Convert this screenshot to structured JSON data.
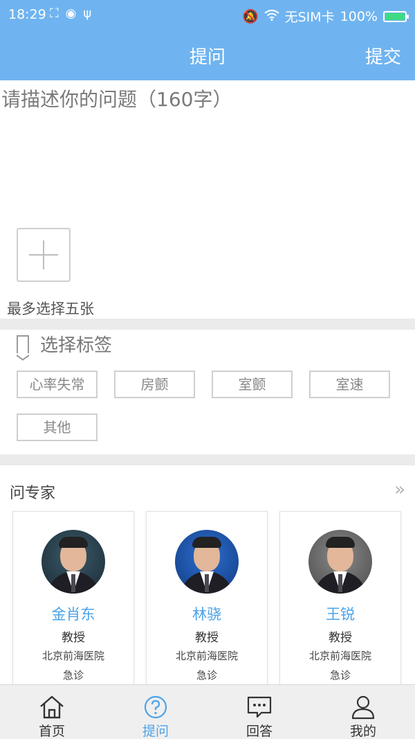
{
  "status_bar": {
    "time": "18:29",
    "left_icons": [
      "screenshot-icon",
      "fish-icon",
      "usb-icon"
    ],
    "network": "无SIM卡",
    "battery_label": "100%",
    "battery_level": 1.0
  },
  "header": {
    "title": "提问",
    "submit_label": "提交"
  },
  "question": {
    "placeholder": "请描述你的问题（160字）",
    "value": ""
  },
  "photos": {
    "hint": "最多选择五张"
  },
  "tags": {
    "title": "选择标签",
    "items": [
      {
        "label": "心率失常"
      },
      {
        "label": "房颤"
      },
      {
        "label": "室颤"
      },
      {
        "label": "室速"
      },
      {
        "label": "其他"
      }
    ]
  },
  "experts": {
    "title": "问专家",
    "items": [
      {
        "name": "金肖东",
        "rank": "教授",
        "hospital": "北京前海医院",
        "dept": "急诊"
      },
      {
        "name": "林骁",
        "rank": "教授",
        "hospital": "北京前海医院",
        "dept": "急诊"
      },
      {
        "name": "王锐",
        "rank": "教授",
        "hospital": "北京前海医院",
        "dept": "急诊"
      }
    ]
  },
  "tabbar": {
    "active": "提问",
    "items": [
      {
        "label": "首页",
        "icon": "home-icon"
      },
      {
        "label": "提问",
        "icon": "question-icon"
      },
      {
        "label": "回答",
        "icon": "chat-icon"
      },
      {
        "label": "我的",
        "icon": "user-icon"
      }
    ]
  },
  "colors": {
    "brand": "#6fb4f0",
    "accent_text": "#4aa3e8",
    "divider": "#ebebeb"
  }
}
